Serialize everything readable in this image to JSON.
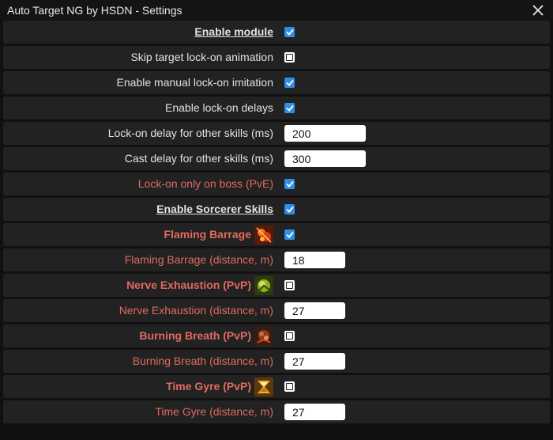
{
  "window": {
    "title": "Auto Target NG by HSDN - Settings"
  },
  "rows": [
    {
      "label": "Enable module",
      "style": "header",
      "control": "checkbox",
      "checked": true
    },
    {
      "label": "Skip target lock-on animation",
      "style": "plain",
      "control": "checkbox",
      "checked": false
    },
    {
      "label": "Enable manual lock-on imitation",
      "style": "plain",
      "control": "checkbox",
      "checked": true
    },
    {
      "label": "Enable lock-on delays",
      "style": "plain",
      "control": "checkbox",
      "checked": true
    },
    {
      "label": "Lock-on delay for other skills (ms)",
      "style": "plain",
      "control": "input",
      "value": "200"
    },
    {
      "label": "Cast delay for other skills (ms)",
      "style": "plain",
      "control": "input",
      "value": "300"
    },
    {
      "label": "Lock-on only on boss (PvE)",
      "style": "red",
      "control": "checkbox",
      "checked": true
    },
    {
      "label": "Enable Sorcerer Skills",
      "style": "header",
      "control": "checkbox",
      "checked": true
    },
    {
      "label": "Flaming Barrage",
      "style": "redbold",
      "icon": "flaming-barrage-icon",
      "control": "checkbox",
      "checked": true
    },
    {
      "label": "Flaming Barrage (distance, m)",
      "style": "red",
      "control": "input",
      "value": "18"
    },
    {
      "label": "Nerve Exhaustion (PvP)",
      "style": "redbold",
      "icon": "nerve-exhaustion-icon",
      "control": "checkbox",
      "checked": false
    },
    {
      "label": "Nerve Exhaustion (distance, m)",
      "style": "red",
      "control": "input",
      "value": "27"
    },
    {
      "label": "Burning Breath (PvP)",
      "style": "redbold",
      "icon": "burning-breath-icon",
      "control": "checkbox",
      "checked": false
    },
    {
      "label": "Burning Breath (distance, m)",
      "style": "red",
      "control": "input",
      "value": "27"
    },
    {
      "label": "Time Gyre (PvP)",
      "style": "redbold",
      "icon": "time-gyre-icon",
      "control": "checkbox",
      "checked": false
    },
    {
      "label": "Time Gyre (distance, m)",
      "style": "red",
      "control": "input",
      "value": "27"
    }
  ],
  "colors": {
    "accent": "#2f8ee8",
    "red_label": "#e06b60",
    "row_bg": "#222222"
  }
}
